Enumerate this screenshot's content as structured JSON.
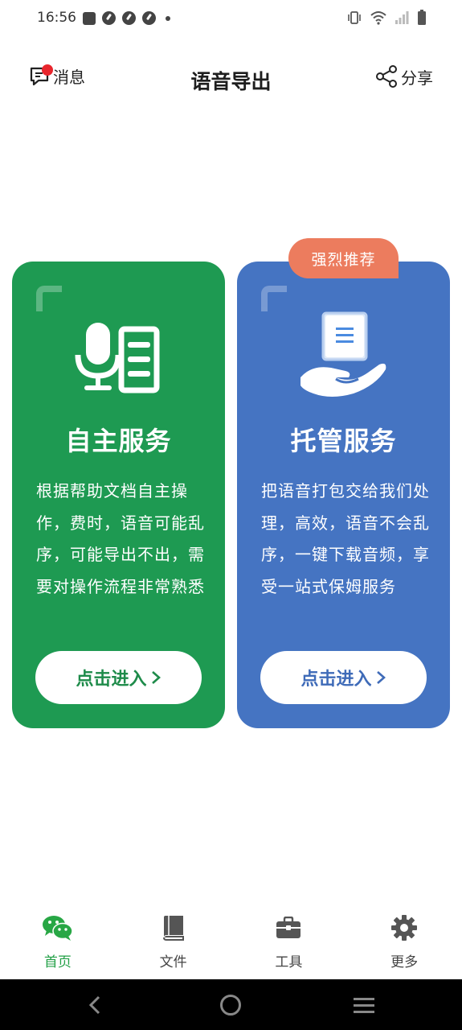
{
  "status_bar": {
    "time": "16:56",
    "left_icons": [
      "message-square-icon",
      "app-circle-icon",
      "app-circle-icon",
      "app-circle-icon",
      "more-dot-icon"
    ],
    "right_icons": [
      "vibrate-icon",
      "wifi-icon",
      "signal-icon",
      "battery-icon"
    ]
  },
  "header": {
    "messages_label": "消息",
    "title": "语音导出",
    "share_label": "分享"
  },
  "cards": [
    {
      "title": "自主服务",
      "description": "根据帮助文档自主操作，费时，语音可能乱序，可能导出不出，需要对操作流程非常熟悉",
      "button_label": "点击进入",
      "icon": "microphone-document-icon",
      "color": "#1e9a52"
    },
    {
      "title": "托管服务",
      "description": "把语音打包交给我们处理，高效，语音不会乱序，一键下载音频，享受一站式保姆服务",
      "button_label": "点击进入",
      "icon": "hand-document-icon",
      "color": "#4574c2",
      "badge": "强烈推荐"
    }
  ],
  "tabs": [
    {
      "label": "首页",
      "icon": "wechat-icon",
      "active": true
    },
    {
      "label": "文件",
      "icon": "book-icon",
      "active": false
    },
    {
      "label": "工具",
      "icon": "toolbox-icon",
      "active": false
    },
    {
      "label": "更多",
      "icon": "gear-icon",
      "active": false
    }
  ],
  "colors": {
    "accent_green": "#23a047",
    "badge_red": "#e8262d",
    "recommend_orange": "#ec7c5e"
  }
}
